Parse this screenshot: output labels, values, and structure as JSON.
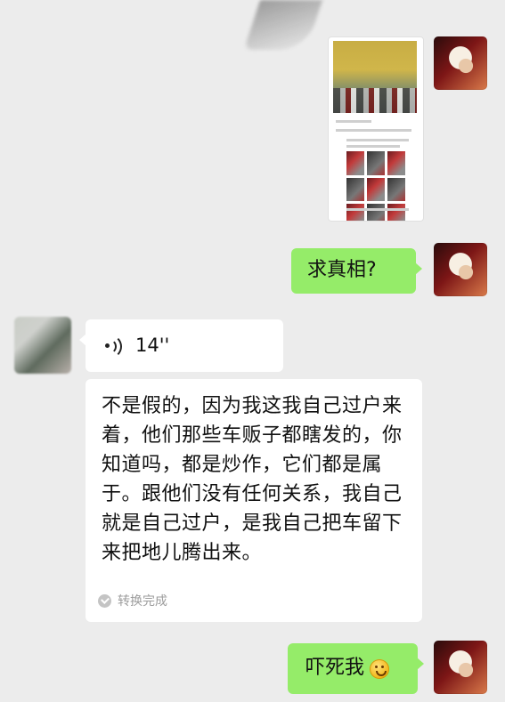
{
  "chat": {
    "messages": [
      {
        "sender": "me",
        "type": "image"
      },
      {
        "sender": "me",
        "type": "text",
        "text": "求真相?"
      },
      {
        "sender": "other",
        "type": "voice",
        "duration": "14''"
      },
      {
        "sender": "other",
        "type": "voice-transcript",
        "text": "不是假的，因为我这我自己过户来着，他们那些车贩子都瞎发的，你知道吗，都是炒作，它们都是属于。跟他们没有任何关系，我自己就是自己过户，是我自己把车留下来把地儿腾出来。",
        "status": "转换完成"
      },
      {
        "sender": "me",
        "type": "text",
        "text": "吓死我",
        "emoji": "sweat-smile-emoji"
      }
    ]
  },
  "colors": {
    "background": "#ececec",
    "me_bubble": "#95ec69",
    "other_bubble": "#ffffff",
    "status_text": "#9c9c9c"
  }
}
